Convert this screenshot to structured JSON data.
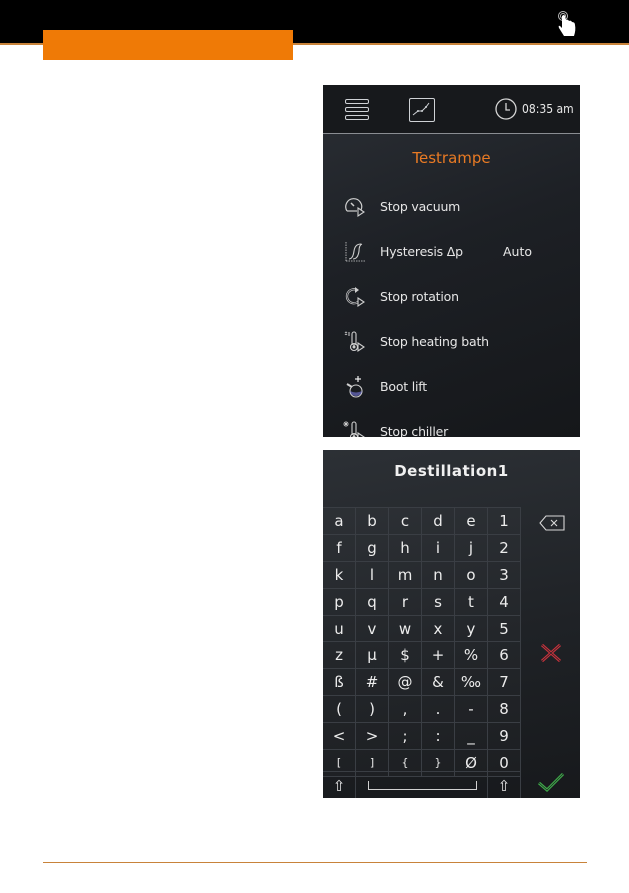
{
  "colors": {
    "accent_orange": "#ef7a06",
    "title_orange": "#e87a24",
    "rule_orange": "#c8833a",
    "cancel_red": "#c8323c",
    "ok_green": "#3fb04a"
  },
  "header": {
    "touch_icon": "hand-touch-icon"
  },
  "screen1": {
    "time": "08:35 am",
    "title": "Testrampe",
    "menu_icon": "hamburger-menu-icon",
    "chart_icon": "ramp-chart-icon",
    "clock_icon": "clock-icon",
    "items": [
      {
        "label": "Stop vacuum",
        "icon": "stop-vacuum-icon",
        "value": ""
      },
      {
        "label": "Hysteresis Δp",
        "icon": "hysteresis-icon",
        "value": "Auto"
      },
      {
        "label": "Stop rotation",
        "icon": "stop-rotation-icon",
        "value": ""
      },
      {
        "label": "Stop heating bath",
        "icon": "stop-heating-bath-icon",
        "value": ""
      },
      {
        "label": "Boot lift",
        "icon": "boot-lift-icon",
        "value": ""
      },
      {
        "label": "Stop chiller",
        "icon": "stop-chiller-icon",
        "value": ""
      }
    ]
  },
  "screen2": {
    "input_value": "Destillation1",
    "keys": [
      [
        "a",
        "b",
        "c",
        "d",
        "e",
        "1"
      ],
      [
        "f",
        "g",
        "h",
        "i",
        "j",
        "2"
      ],
      [
        "k",
        "l",
        "m",
        "n",
        "o",
        "3"
      ],
      [
        "p",
        "q",
        "r",
        "s",
        "t",
        "4"
      ],
      [
        "u",
        "v",
        "w",
        "x",
        "y",
        "5"
      ],
      [
        "z",
        "µ",
        "$",
        "+",
        "%",
        "6"
      ],
      [
        "ß",
        "#",
        "@",
        "&",
        "‰",
        "7"
      ],
      [
        "(",
        ")",
        ",",
        ".",
        "-",
        "8"
      ],
      [
        "<",
        ">",
        ";",
        ":",
        "_",
        "9"
      ],
      [
        "[",
        "]",
        "{",
        "}",
        "Ø",
        "0"
      ]
    ],
    "shift_label": "⇧",
    "backspace_icon": "backspace-icon",
    "cancel_icon": "cancel-x-icon",
    "confirm_icon": "checkmark-icon"
  }
}
